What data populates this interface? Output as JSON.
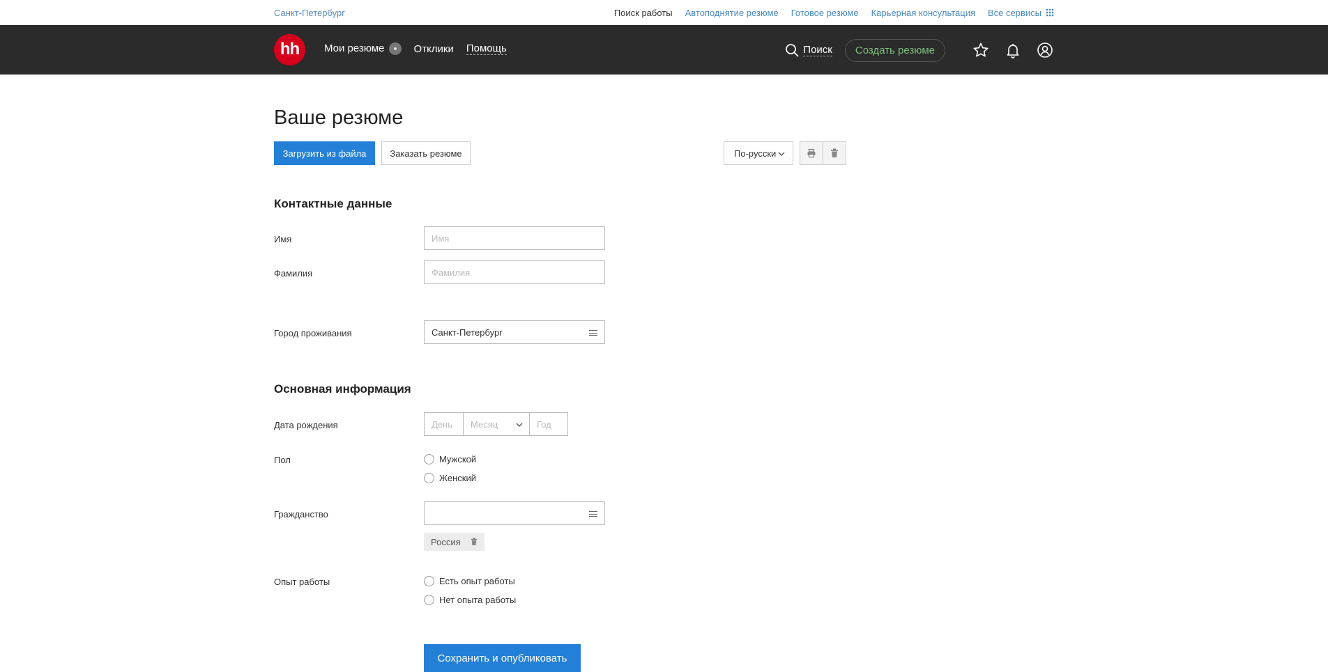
{
  "topbar": {
    "city": "Санкт-Петербург",
    "links": [
      "Поиск работы",
      "Автоподнятие резюме",
      "Готовое резюме",
      "Карьерная консультация",
      "Все сервисы"
    ]
  },
  "header": {
    "logo_text": "hh",
    "nav": {
      "my_resumes": "Мои резюме",
      "responses": "Отклики",
      "help": "Помощь"
    },
    "search_label": "Поиск",
    "create_button": "Создать резюме"
  },
  "page": {
    "title": "Ваше резюме",
    "upload_button": "Загрузить из файла",
    "order_button": "Заказать резюме",
    "language": "По-русски"
  },
  "contacts": {
    "title": "Контактные данные",
    "first_name_label": "Имя",
    "first_name_placeholder": "Имя",
    "last_name_label": "Фамилия",
    "last_name_placeholder": "Фамилия",
    "city_label": "Город проживания",
    "city_value": "Санкт-Петербург"
  },
  "basic": {
    "title": "Основная информация",
    "birth_label": "Дата рождения",
    "birth_day": "День",
    "birth_month": "Месяц",
    "birth_year": "Год",
    "gender_label": "Пол",
    "gender_male": "Мужской",
    "gender_female": "Женский",
    "citizenship_label": "Гражданство",
    "citizenship_value": "",
    "citizenship_tag": "Россия",
    "experience_label": "Опыт работы",
    "experience_yes": "Есть опыт работы",
    "experience_no": "Нет опыта работы"
  },
  "save_button": "Сохранить и опубликовать",
  "colors": {
    "accent": "#2480d6",
    "header_bg": "#2b2b2b",
    "logo": "#d6001c",
    "link": "#4a8ac0"
  }
}
